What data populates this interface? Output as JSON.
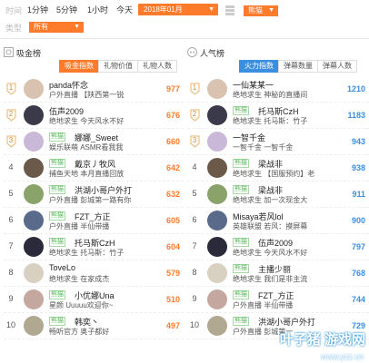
{
  "filters": {
    "time_label": "时间",
    "category_label": "类型",
    "time_options": [
      "1分钟",
      "5分钟",
      "1小时",
      "今天"
    ],
    "date_selected": "2018年01月",
    "game_selected": "熊猫",
    "category_selected": "所有"
  },
  "colors": {
    "accent": "#ff7b2c",
    "value_left": "#ff7b2c",
    "value_right": "#3b8fe0",
    "tag": "#5cb85c"
  },
  "left_panel": {
    "title": "吸金榜",
    "tabs": [
      "吸金指数",
      "礼物价值",
      "礼物人数"
    ],
    "active_tab": 0,
    "rows": [
      {
        "rank": "1",
        "tag": "",
        "name": "panda怀念",
        "desc": "户外直播 【陕西第一锐",
        "value": "977"
      },
      {
        "rank": "2",
        "tag": "",
        "name": "伍声2009",
        "desc": "绝地求生 今天风水不好",
        "value": "676"
      },
      {
        "rank": "3",
        "tag": "熊猫",
        "name": "娜娜_Sweet",
        "desc": "娱乐联萌 ASMR看我我",
        "value": "660"
      },
      {
        "rank": "4",
        "tag": "熊猫",
        "name": "戴京丿牧风",
        "desc": "捕鱼天地 本月直播回放",
        "value": "642"
      },
      {
        "rank": "5",
        "tag": "熊猫",
        "name": "洪湖小哥户外打",
        "desc": "户外直播 彭城第一路有你",
        "value": "632"
      },
      {
        "rank": "6",
        "tag": "熊猫",
        "name": "FZT_方正",
        "desc": "户外直播 半仙带播",
        "value": "605"
      },
      {
        "rank": "7",
        "tag": "熊猫",
        "name": "托马斯CzH",
        "desc": "绝地求生 托马斯：竹子",
        "value": "604"
      },
      {
        "rank": "8",
        "tag": "",
        "name": "ToveLo",
        "desc": "绝地求生 在家成杰",
        "value": "579"
      },
      {
        "rank": "9",
        "tag": "熊猫",
        "name": "小优娜Una",
        "desc": "星颜 Uuuuu欢迎你~",
        "value": "510"
      },
      {
        "rank": "10",
        "tag": "熊猫",
        "name": "韩奕丶",
        "desc": "畅听官方 奥子都好",
        "value": "497"
      }
    ]
  },
  "right_panel": {
    "title": "人气榜",
    "tabs": [
      "火力指数",
      "弹幕数量",
      "弹幕人数"
    ],
    "active_tab": 0,
    "rows": [
      {
        "rank": "1",
        "tag": "",
        "name": "一仙某某一",
        "desc": "绝地求生 神秘的直播间",
        "value": "1210"
      },
      {
        "rank": "2",
        "tag": "熊猫",
        "name": "托马斯CzH",
        "desc": "绝地求生 托马斯：竹子",
        "value": "1183"
      },
      {
        "rank": "3",
        "tag": "",
        "name": "一智千金",
        "desc": "一智千金 一智千金",
        "value": "943"
      },
      {
        "rank": "4",
        "tag": "熊猫",
        "name": "梁战非",
        "desc": "绝地求生 【国服预约】老",
        "value": "938"
      },
      {
        "rank": "5",
        "tag": "熊猫",
        "name": "梁战非",
        "desc": "绝地求生 加一次现金大",
        "value": "911"
      },
      {
        "rank": "6",
        "tag": "",
        "name": "Misaya若风lol",
        "desc": "英雄联盟 若风：摸屏幕",
        "value": "900"
      },
      {
        "rank": "7",
        "tag": "熊猫",
        "name": "伍声2009",
        "desc": "绝地求生 今天风水不好",
        "value": "797"
      },
      {
        "rank": "8",
        "tag": "熊猫",
        "name": "主播少丽",
        "desc": "绝地求生 我们是非主流",
        "value": "768"
      },
      {
        "rank": "9",
        "tag": "熊猫",
        "name": "FZT_方正",
        "desc": "户外直播 半仙带播",
        "value": "744"
      },
      {
        "rank": "10",
        "tag": "熊猫",
        "name": "洪湖小哥户外打",
        "desc": "户外直播 彭城第一",
        "value": "729"
      }
    ]
  },
  "watermark": {
    "title": "叶子猪 游戏网",
    "url": "www.yzz.cn"
  }
}
